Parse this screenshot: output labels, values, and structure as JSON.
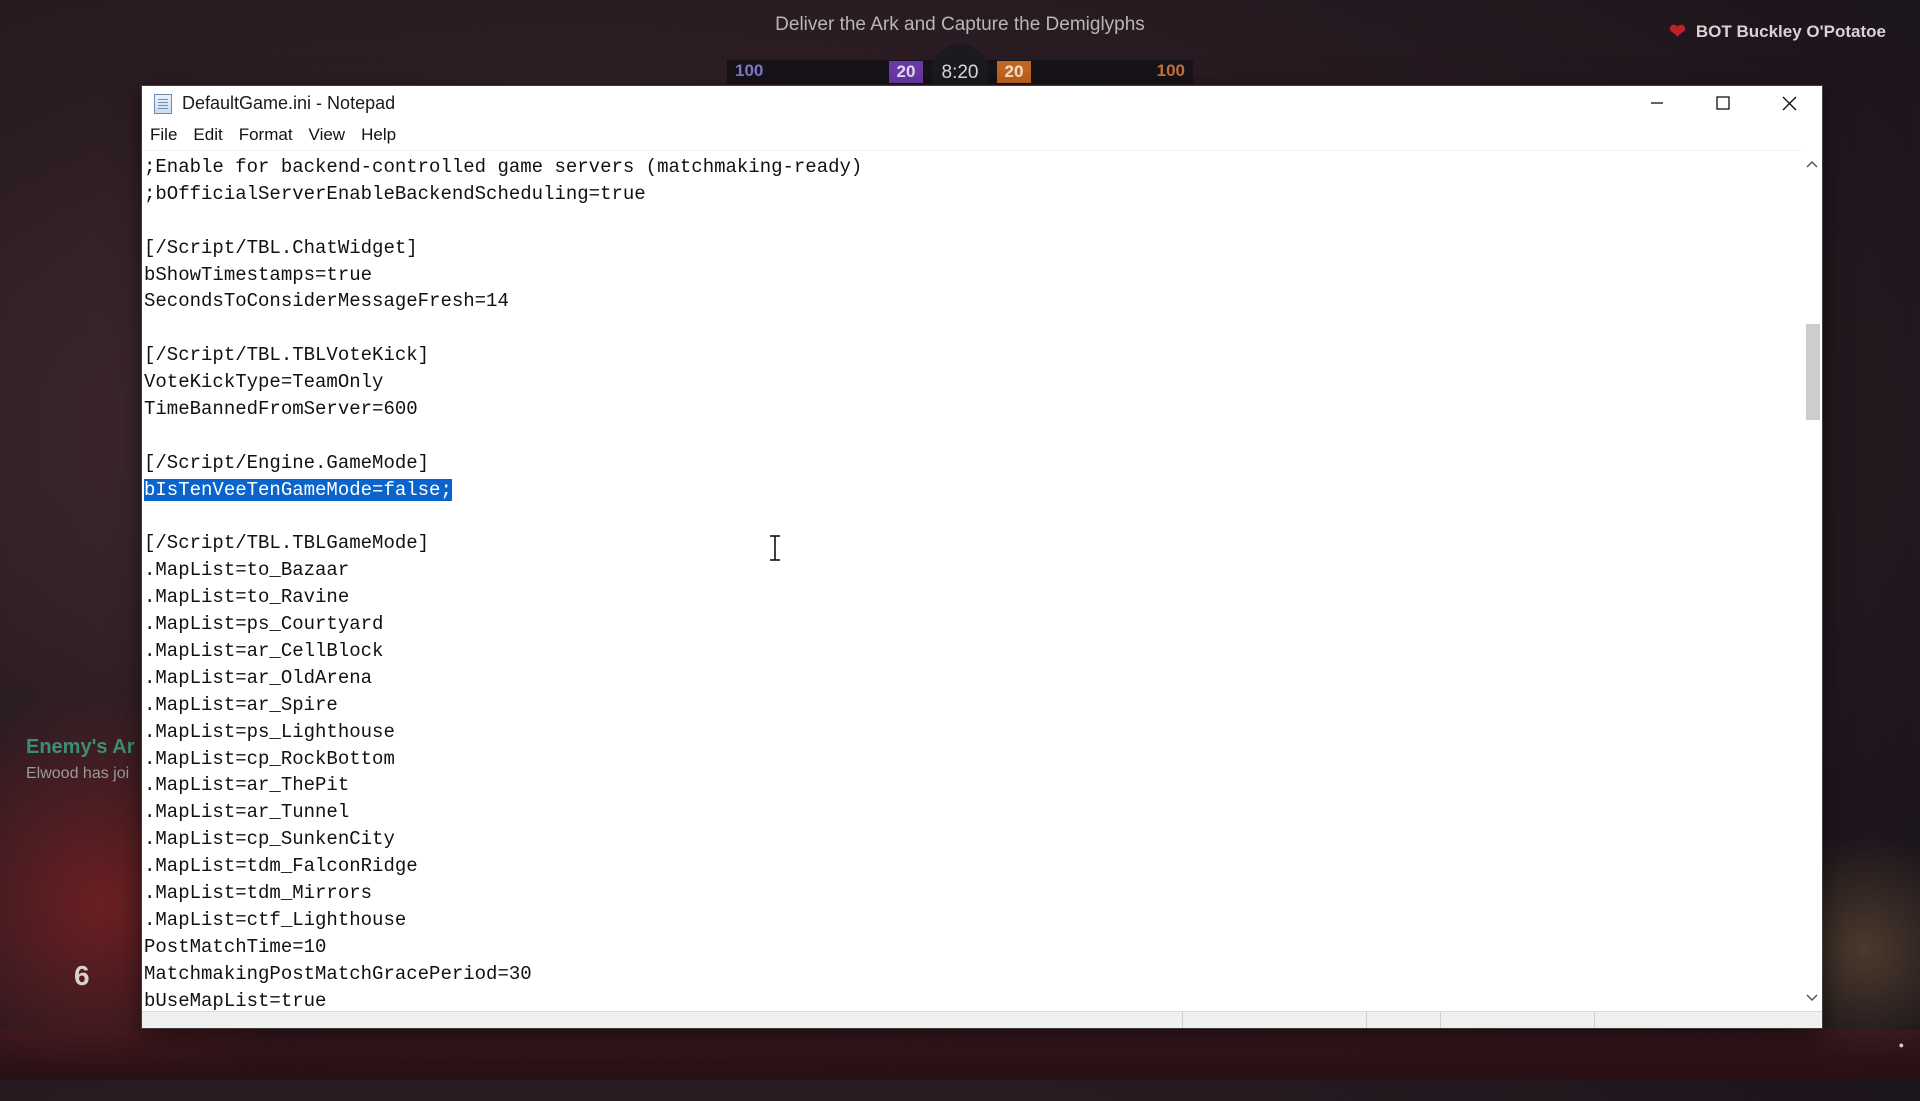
{
  "hud": {
    "objective": "Deliver the Ark and Capture the Demiglyphs",
    "player_name": "BOT Buckley O'Potatoe",
    "left_hp": "100",
    "left_score": "20",
    "timer": "8:20",
    "right_score": "20",
    "right_hp": "100",
    "feed_title": "Enemy's Ar",
    "feed_subtitle": "Elwood has joi",
    "ammo": "6"
  },
  "window": {
    "title": "DefaultGame.ini - Notepad",
    "icon": "notepad-icon",
    "controls": [
      "minimize-icon",
      "maximize-icon",
      "close-icon"
    ]
  },
  "menu": [
    "File",
    "Edit",
    "Format",
    "View",
    "Help"
  ],
  "editor": {
    "lines": [
      ";Enable for backend-controlled game servers (matchmaking-ready)",
      ";bOfficialServerEnableBackendScheduling=true",
      "",
      "[/Script/TBL.ChatWidget]",
      "bShowTimestamps=true",
      "SecondsToConsiderMessageFresh=14",
      "",
      "[/Script/TBL.TBLVoteKick]",
      "VoteKickType=TeamOnly",
      "TimeBannedFromServer=600",
      "",
      "[/Script/Engine.GameMode]",
      "bIsTenVeeTenGameMode=false;",
      "",
      "[/Script/TBL.TBLGameMode]",
      ".MapList=to_Bazaar",
      ".MapList=to_Ravine",
      ".MapList=ps_Courtyard",
      ".MapList=ar_CellBlock",
      ".MapList=ar_OldArena",
      ".MapList=ar_Spire",
      ".MapList=ps_Lighthouse",
      ".MapList=cp_RockBottom",
      ".MapList=ar_ThePit",
      ".MapList=ar_Tunnel",
      ".MapList=cp_SunkenCity",
      ".MapList=tdm_FalconRidge",
      ".MapList=tdm_Mirrors",
      ".MapList=ctf_Lighthouse",
      "PostMatchTime=10",
      "MatchmakingPostMatchGracePeriod=30",
      "bUseMapList=true"
    ],
    "selected_line_index": 12
  },
  "colors": {
    "selection": "#0a64cc",
    "left_team": "#6c3aa8",
    "right_team": "#c4661f"
  }
}
